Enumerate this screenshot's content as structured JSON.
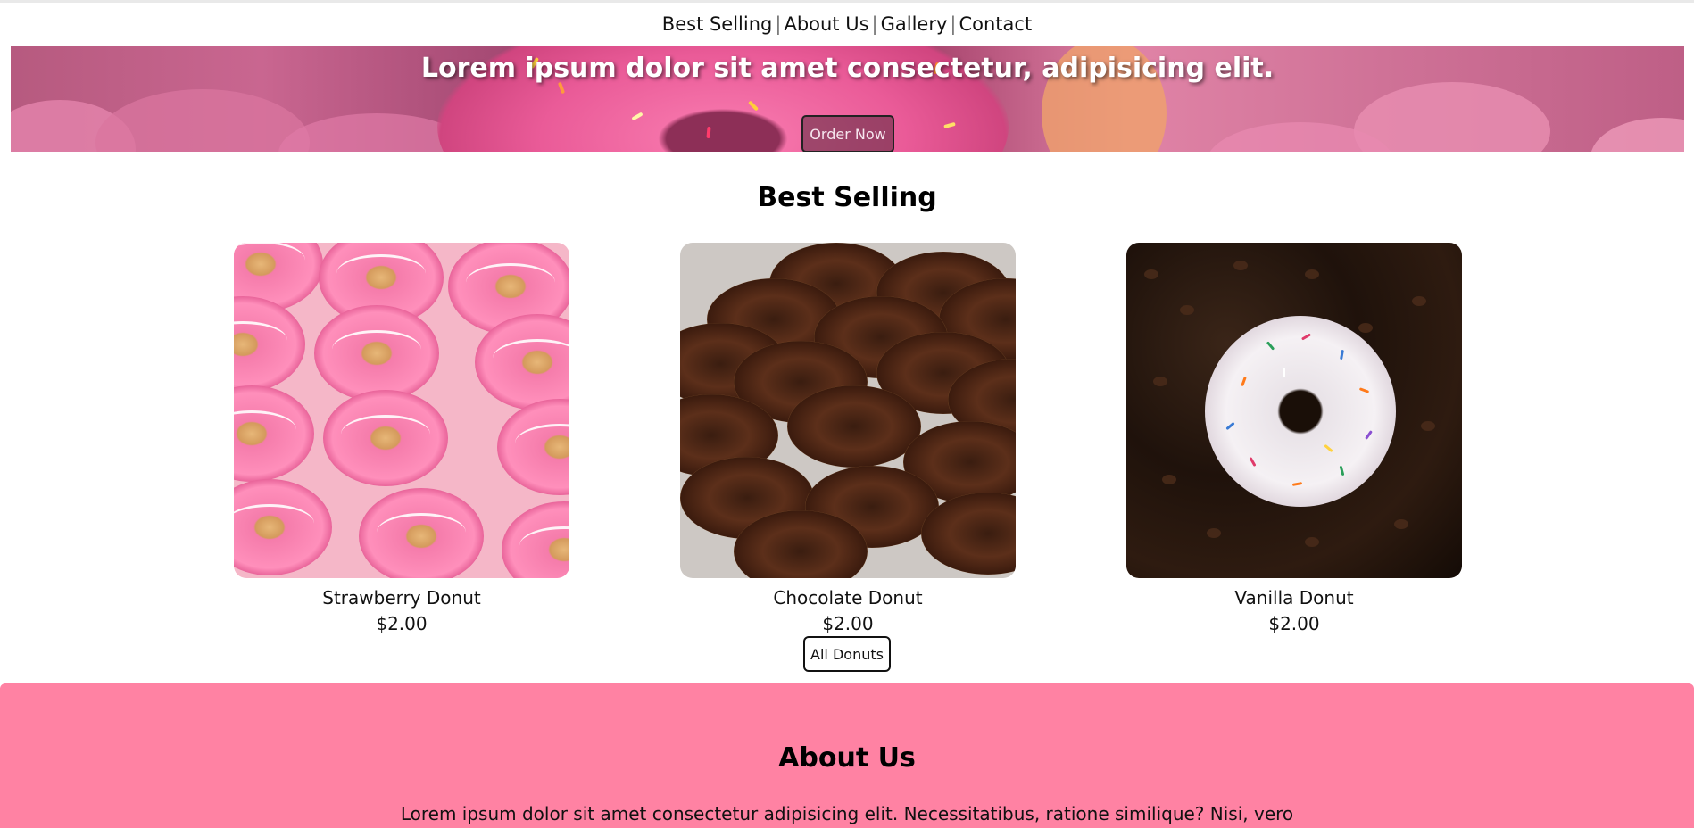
{
  "nav": {
    "items": [
      {
        "label": "Best Selling"
      },
      {
        "label": "About Us"
      },
      {
        "label": "Gallery"
      },
      {
        "label": "Contact"
      }
    ],
    "separator": "|"
  },
  "hero": {
    "headline": "Lorem ipsum dolor sit amet consectetur, adipisicing elit.",
    "cta_label": "Order Now"
  },
  "best_selling": {
    "title": "Best Selling",
    "products": [
      {
        "name": "Strawberry Donut",
        "price": "$2.00"
      },
      {
        "name": "Chocolate Donut",
        "price": "$2.00"
      },
      {
        "name": "Vanilla Donut",
        "price": "$2.00"
      }
    ],
    "all_button_label": "All Donuts"
  },
  "about": {
    "title": "About Us",
    "text": "Lorem ipsum dolor sit amet consectetur adipisicing elit. Necessitatibus, ratione similique? Nisi, vero"
  },
  "colors": {
    "about_background": "#ff82a3",
    "hero_pink": "#d25c8e",
    "text": "#111111"
  }
}
